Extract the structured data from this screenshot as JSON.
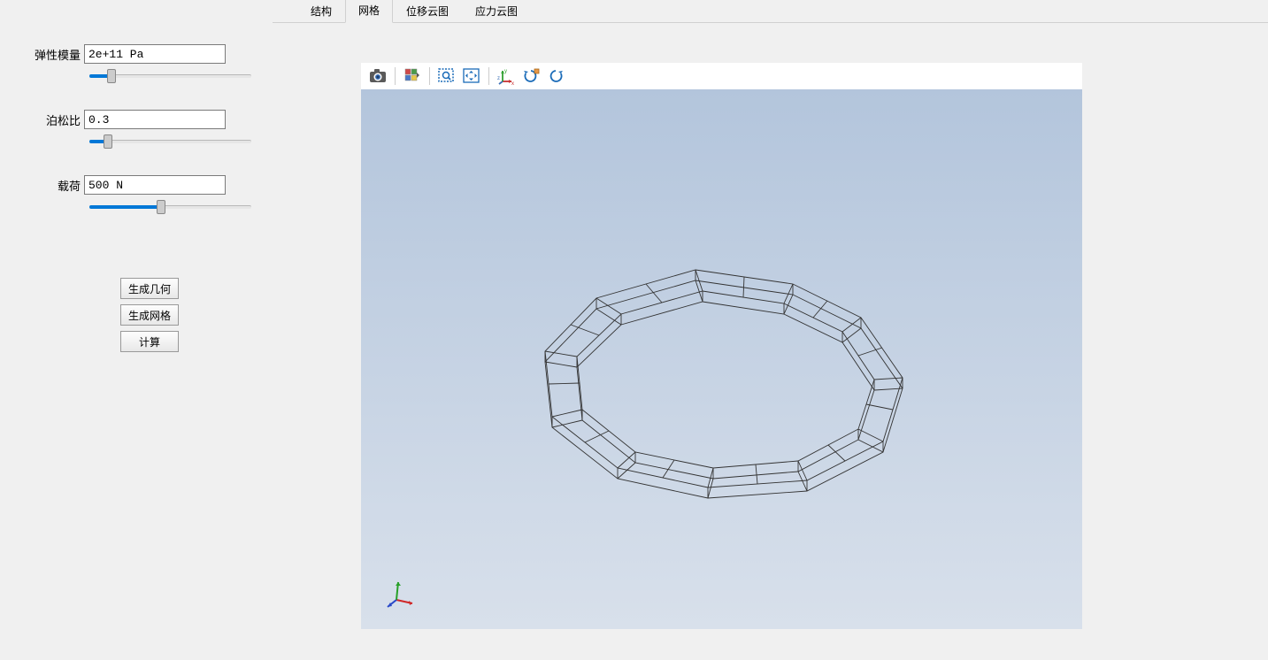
{
  "sidebar": {
    "elastic": {
      "label": "弹性模量",
      "value": "2e+11 Pa",
      "slider_pct": 13
    },
    "poisson": {
      "label": "泊松比",
      "value": "0.3",
      "slider_pct": 11
    },
    "load": {
      "label": "载荷",
      "value": "500 N",
      "slider_pct": 42
    },
    "buttons": {
      "gen_geom": "生成几何",
      "gen_mesh": "生成网格",
      "compute": "计算"
    }
  },
  "tabs": {
    "items": [
      {
        "label": "结构",
        "active": false
      },
      {
        "label": "网格",
        "active": true
      },
      {
        "label": "位移云图",
        "active": false
      },
      {
        "label": "应力云图",
        "active": false
      }
    ]
  },
  "toolbar_icons": {
    "camera": "camera",
    "palette": "palette",
    "zoom_box": "zoom-area",
    "pan": "pan",
    "axes": "axes",
    "rotate_cw": "rotate-cw",
    "rotate_ccw": "rotate-ccw"
  },
  "triad_labels": {
    "x": "x",
    "y": "y",
    "z": "z"
  }
}
